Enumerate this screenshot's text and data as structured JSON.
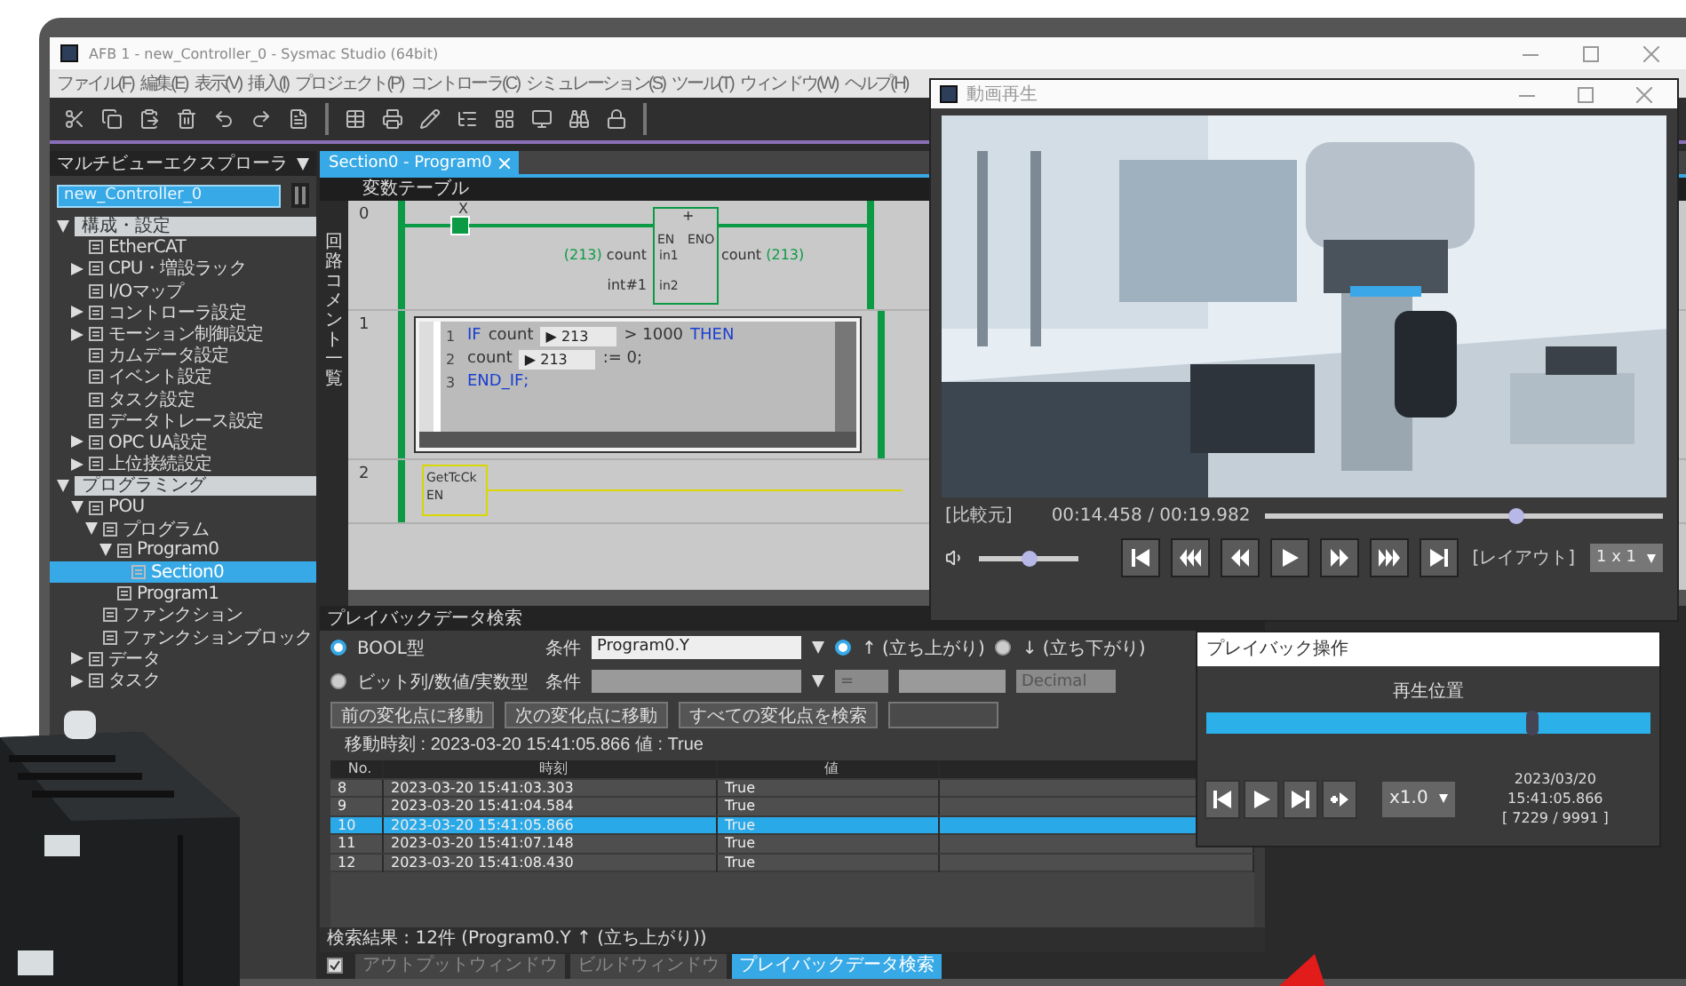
{
  "main_window": {
    "title": "AFB 1 - new_Controller_0 - Sysmac Studio (64bit)",
    "menu": [
      "ファイル(F)",
      "編集(E)",
      "表示(V)",
      "挿入(I)",
      "プロジェクト(P)",
      "コントローラ(C)",
      "シミュレーション(S)",
      "ツール(T)",
      "ウィンドウ(W)",
      "ヘルプ(H)"
    ]
  },
  "explorer": {
    "title": "マルチビューエクスプローラ",
    "controller": "new_Controller_0",
    "tree": [
      {
        "label": "構成・設定",
        "kind": "section",
        "expanded": true,
        "selected": false,
        "children": [
          {
            "label": "EtherCAT",
            "selected": false
          },
          {
            "label": "CPU・増設ラック",
            "expanded": false,
            "selected": false
          },
          {
            "label": "I/Oマップ",
            "selected": false
          },
          {
            "label": "コントローラ設定",
            "expanded": false,
            "selected": false
          },
          {
            "label": "モーション制御設定",
            "expanded": false,
            "selected": false
          },
          {
            "label": "カムデータ設定",
            "selected": false
          },
          {
            "label": "イベント設定",
            "selected": false
          },
          {
            "label": "タスク設定",
            "selected": false
          },
          {
            "label": "データトレース設定",
            "selected": false
          },
          {
            "label": "OPC UA設定",
            "expanded": false,
            "selected": false
          },
          {
            "label": "上位接続設定",
            "expanded": false,
            "selected": false
          }
        ]
      },
      {
        "label": "プログラミング",
        "kind": "section",
        "expanded": true,
        "selected": false,
        "children": [
          {
            "label": "POU",
            "expanded": true,
            "selected": false,
            "children": [
              {
                "label": "プログラム",
                "expanded": true,
                "selected": false,
                "children": [
                  {
                    "label": "Program0",
                    "expanded": true,
                    "selected": false,
                    "children": [
                      {
                        "label": "Section0",
                        "selected": true
                      }
                    ]
                  },
                  {
                    "label": "Program1",
                    "selected": false
                  }
                ]
              },
              {
                "label": "ファンクション",
                "selected": false
              },
              {
                "label": "ファンクションブロック",
                "selected": false
              }
            ]
          },
          {
            "label": "データ",
            "expanded": false,
            "selected": false
          },
          {
            "label": "タスク",
            "expanded": false,
            "selected": false
          }
        ]
      }
    ]
  },
  "editor": {
    "tab": "Section0 - Program0",
    "variable_table": "変数テーブル",
    "side_label": "回路コメント一覧",
    "rungs": [
      {
        "number": "0",
        "kind": "ladder",
        "contact": "X",
        "block": "+",
        "en": "EN",
        "eno": "ENO",
        "in1": {
          "pin": "in1",
          "var": "count",
          "value": "(213)"
        },
        "in2": {
          "pin": "in2",
          "var": "int#1"
        },
        "out": {
          "var": "count",
          "value": "(213)"
        }
      },
      {
        "number": "1",
        "kind": "st",
        "lines": [
          {
            "number": "1",
            "tokens": [
              {
                "kind": "keyword",
                "text": "IF"
              },
              {
                "kind": "var",
                "text": "count"
              },
              {
                "kind": "watch",
                "text": "▶ 213"
              },
              {
                "kind": "plain",
                "text": "> 1000"
              },
              {
                "kind": "keyword",
                "text": "THEN"
              }
            ]
          },
          {
            "number": "2",
            "tokens": [
              {
                "kind": "var",
                "text": "count"
              },
              {
                "kind": "watch",
                "text": "▶ 213"
              },
              {
                "kind": "plain",
                "text": ":= 0;"
              }
            ]
          },
          {
            "number": "3",
            "tokens": [
              {
                "kind": "keyword",
                "text": "END_IF;"
              }
            ]
          }
        ]
      },
      {
        "number": "2",
        "kind": "block",
        "name": "GetTcCk",
        "pin": "EN"
      }
    ]
  },
  "search": {
    "title": "プレイバックデータ検索",
    "modes": [
      {
        "label": "BOOL型",
        "selected": true,
        "condition_label": "条件",
        "value": "Program0.Y",
        "disabled": false
      },
      {
        "label": "ビット列/数値/実数型",
        "selected": false,
        "condition_label": "条件",
        "disabled": true
      }
    ],
    "edges": [
      {
        "label": "↑ (立ち上がり)",
        "selected": true
      },
      {
        "label": "↓ (立ち下がり)",
        "selected": false
      }
    ],
    "operator": "=",
    "format": "Decimal",
    "buttons": [
      {
        "label": "前の変化点に移動",
        "disabled": false
      },
      {
        "label": "次の変化点に移動",
        "disabled": false
      },
      {
        "label": "すべての変化点を検索",
        "disabled": false
      },
      {
        "disabled": true
      }
    ],
    "jump_info": "移動時刻 : 2023-03-20 15:41:05.866   値 : True",
    "columns": [
      "No.",
      "時刻",
      "値"
    ],
    "rows": [
      {
        "cells": [
          "8",
          "2023-03-20 15:41:03.303",
          "True"
        ],
        "selected": false
      },
      {
        "cells": [
          "9",
          "2023-03-20 15:41:04.584",
          "True"
        ],
        "selected": false
      },
      {
        "cells": [
          "10",
          "2023-03-20 15:41:05.866",
          "True"
        ],
        "selected": true
      },
      {
        "cells": [
          "11",
          "2023-03-20 15:41:07.148",
          "True"
        ],
        "selected": false
      },
      {
        "cells": [
          "12",
          "2023-03-20 15:41:08.430",
          "True"
        ],
        "selected": false
      }
    ],
    "result": "検索結果 : 12件 (Program0.Y ↑ (立ち上がり))"
  },
  "output_checkbox": {
    "checked": true
  },
  "bottom_tabs": [
    {
      "label": "アウトプットウィンドウ",
      "selected": false
    },
    {
      "label": "ビルドウィンドウ",
      "selected": false
    },
    {
      "label": "プレイバックデータ検索",
      "selected": true
    }
  ],
  "video_window": {
    "title": "動画再生",
    "source_label": "[比較元]",
    "time": "00:14.458 / 00:19.982",
    "position": {
      "level": 0.63
    },
    "volume": {
      "level": 0.5
    },
    "layout_label": "[レイアウト]",
    "layout": "1 x 1"
  },
  "playback": {
    "title": "プレイバック操作",
    "position_label": "再生位置",
    "position": {
      "level": 0.73
    },
    "speed": "x1.0",
    "date": "2023/03/20",
    "time": "15:41:05.866",
    "counter": "[ 7229 / 9991 ]"
  }
}
